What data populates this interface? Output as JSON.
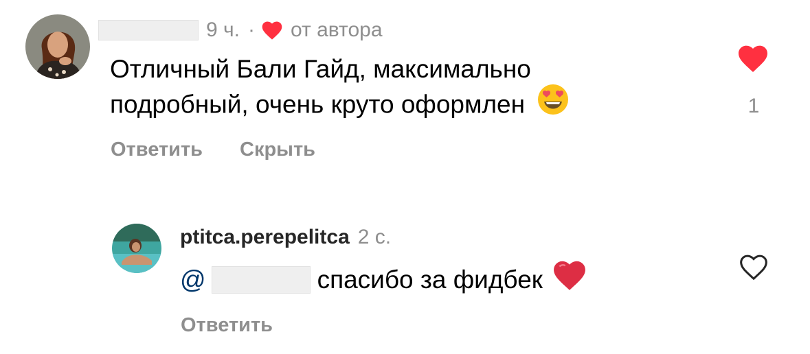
{
  "comment": {
    "time": "9 ч.",
    "separator": "·",
    "liked_by_author_label": "от автора",
    "text_line1": "Отличный Бали Гайд, максимально",
    "text_line2": "подробный, очень круто оформлен",
    "emoji": "heart-eyes-emoji",
    "like_count": "1",
    "actions": {
      "reply": "Ответить",
      "hide": "Скрыть"
    },
    "like_color": "#ff3040"
  },
  "reply": {
    "username": "ptitca.perepelitca",
    "time": "2 с.",
    "mention_prefix": "@",
    "text": "спасибо за фидбек",
    "emoji": "red-heart-emoji",
    "actions": {
      "reply": "Ответить"
    },
    "mention_color": "#00376b"
  }
}
